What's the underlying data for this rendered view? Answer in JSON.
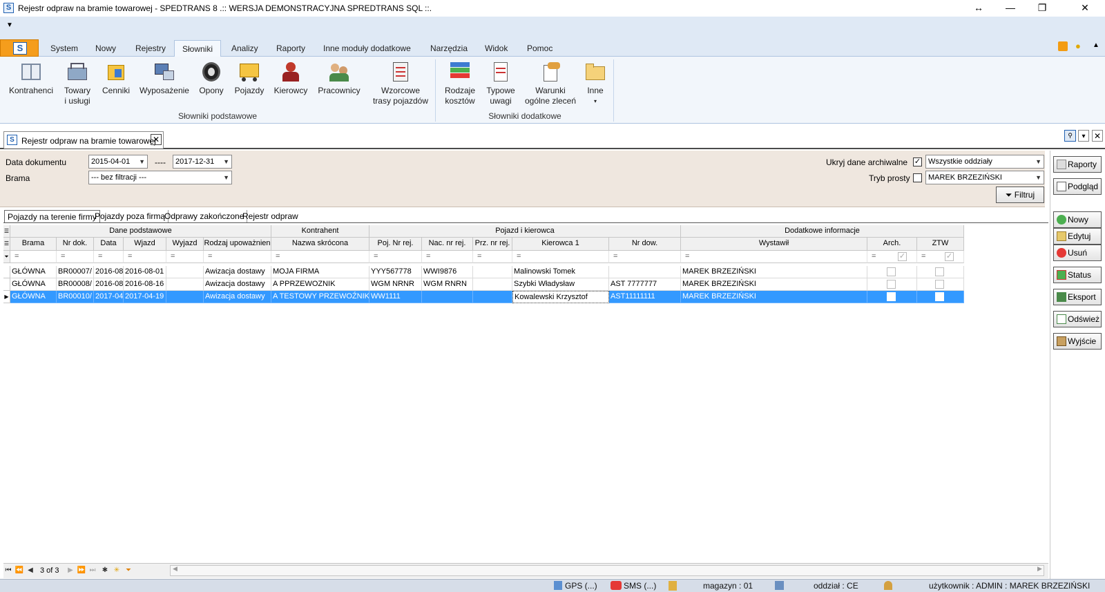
{
  "window": {
    "title": "Rejestr odpraw na bramie towarowej - SPEDTRANS 8 .:: WERSJA DEMONSTRACYJNA SPREDTRANS SQL ::."
  },
  "ribbon": {
    "tabs": [
      "System",
      "Nowy",
      "Rejestry",
      "Słowniki",
      "Analizy",
      "Raporty",
      "Inne moduły dodatkowe",
      "Narzędzia",
      "Widok",
      "Pomoc"
    ],
    "active_tab": "Słowniki",
    "buttons": [
      {
        "l1": "Kontrahenci",
        "l2": ""
      },
      {
        "l1": "Towary",
        "l2": "i usługi"
      },
      {
        "l1": "Cenniki",
        "l2": ""
      },
      {
        "l1": "Wyposażenie",
        "l2": ""
      },
      {
        "l1": "Opony",
        "l2": ""
      },
      {
        "l1": "Pojazdy",
        "l2": ""
      },
      {
        "l1": "Kierowcy",
        "l2": ""
      },
      {
        "l1": "Pracownicy",
        "l2": ""
      },
      {
        "l1": "Wzorcowe",
        "l2": "trasy pojazdów"
      },
      {
        "l1": "Rodzaje",
        "l2": "kosztów"
      },
      {
        "l1": "Typowe",
        "l2": "uwagi"
      },
      {
        "l1": "Warunki",
        "l2": "ogólne zleceń"
      },
      {
        "l1": "Inne",
        "l2": "▾"
      }
    ],
    "groups": [
      "Słowniki podstawowe",
      "Słowniki dodatkowe"
    ]
  },
  "doc_tab": {
    "label": "Rejestr odpraw na bramie towarowej"
  },
  "filter": {
    "date_label": "Data dokumentu",
    "date_from": "2015-04-01",
    "date_sep": "----",
    "date_to": "2017-12-31",
    "gate_label": "Brama",
    "gate_value": "--- bez filtracji ---",
    "hide_archive_label": "Ukryj dane archiwalne",
    "simple_mode_label": "Tryb prosty",
    "branch_value": "Wszystkie oddziały",
    "user_value": "MAREK BRZEZIŃSKI",
    "filter_button": "Filtruj"
  },
  "side_buttons": [
    "Raporty",
    "Podgląd",
    "Nowy",
    "Edytuj",
    "Usuń",
    "Status",
    "Eksport",
    "Odśwież",
    "Wyjście"
  ],
  "subtabs": [
    "Pojazdy na terenie firmy",
    "Pojazdy poza firmą",
    "Odprawy zakończone",
    "Rejestr odpraw"
  ],
  "grid": {
    "bands": [
      "Dane podstawowe",
      "Kontrahent",
      "Pojazd i kierowca",
      "Dodatkowe informacje"
    ],
    "columns": [
      "Brama",
      "Nr dok.",
      "Data",
      "Wjazd",
      "Wyjazd",
      "Rodzaj upoważnien",
      "Nazwa skrócona",
      "Poj. Nr rej.",
      "Nac. nr rej.",
      "Prz. nr rej.",
      "Kierowca 1",
      "Nr dow.",
      "Wystawił",
      "Arch.",
      "ZTW"
    ],
    "filter_symbol": "=",
    "rows": [
      [
        "GŁÓWNA",
        "BR00007/",
        "2016-08",
        "2016-08-01",
        "",
        "Awizacja dostawy",
        "MOJA FIRMA",
        "YYY567778",
        "WWI9876",
        "",
        "Malinowski Tomek",
        "",
        "MAREK BRZEZIŃSKI",
        "",
        ""
      ],
      [
        "GŁÓWNA",
        "BR00008/",
        "2016-08",
        "2016-08-16",
        "",
        "Awizacja dostawy",
        "A PPRZEWOZNIK",
        "WGM NRNR",
        "WGM RNRN",
        "",
        "Szybki Władysław",
        "AST 7777777",
        "MAREK BRZEZIŃSKI",
        "",
        ""
      ],
      [
        "GŁÓWNA",
        "BR00010/",
        "2017-04",
        "2017-04-19",
        "",
        "Awizacja dostawy",
        "A TESTOWY PRZEWOŹNIK",
        "WW1111",
        "",
        "",
        "Kowalewski Krzysztof",
        "AST11111111",
        "MAREK BRZEZIŃSKI",
        "",
        ""
      ]
    ]
  },
  "nav": {
    "record": "3 of 3"
  },
  "statusbar": {
    "gps": "GPS (...)",
    "sms": "SMS (...)",
    "magazyn": "magazyn : 01",
    "oddzial": "oddział : CE",
    "user": "użytkownik : ADMIN : MAREK BRZEZIŃSKI"
  },
  "colors": {
    "accent": "#f59d1c",
    "ribbon_bg": "#dfe9f5",
    "filter_bg": "#efe7df",
    "selection": "#3399ff"
  }
}
